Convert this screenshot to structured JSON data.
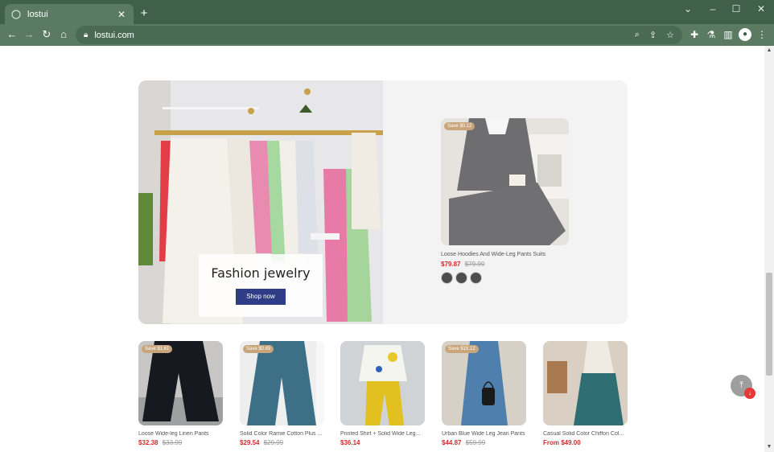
{
  "browser": {
    "tab_title": "lostui",
    "tab_close": "✕",
    "new_tab": "+",
    "url": "lostui.com",
    "icons": [
      "back-icon",
      "forward-icon",
      "reload-icon",
      "home-icon",
      "lock-icon",
      "zoom-icon",
      "share-icon",
      "star-icon",
      "extensions-icon",
      "flask-icon",
      "sidepanel-icon",
      "profile-icon",
      "menu-icon"
    ]
  },
  "hero": {
    "heading": "Fashion jewelry",
    "button_label": "Shop now",
    "feature": {
      "badge": "Save $0.12",
      "name": "Loose Hoodies And Wide-Leg Pants Suits",
      "price": "$79.87",
      "original_price": "$79.99"
    }
  },
  "products": [
    {
      "badge": "Save $1.61",
      "name": "Loose Wide-leg Linen Pants",
      "price": "$32.38",
      "original_price": "$33.99"
    },
    {
      "badge": "Save $0.45",
      "name": "Solid Color Ramie Cotton Plus ...",
      "price": "$29.54",
      "original_price": "$29.99"
    },
    {
      "badge": "",
      "name": "Printed Shirt + Solid Wide Leg...",
      "price": "$36.14",
      "original_price": ""
    },
    {
      "badge": "Save $15.12",
      "name": "Urban Blue Wide Leg Jean Pants",
      "price": "$44.87",
      "original_price": "$59.99"
    },
    {
      "badge": "",
      "name": "Casual Solid Color Chiffon Col...",
      "price": "From $49.00",
      "original_price": ""
    }
  ],
  "colors": {
    "chrome": "#40604a",
    "button": "#2e3d85",
    "sale": "#d12b2b",
    "badge": "#c9a57b"
  }
}
